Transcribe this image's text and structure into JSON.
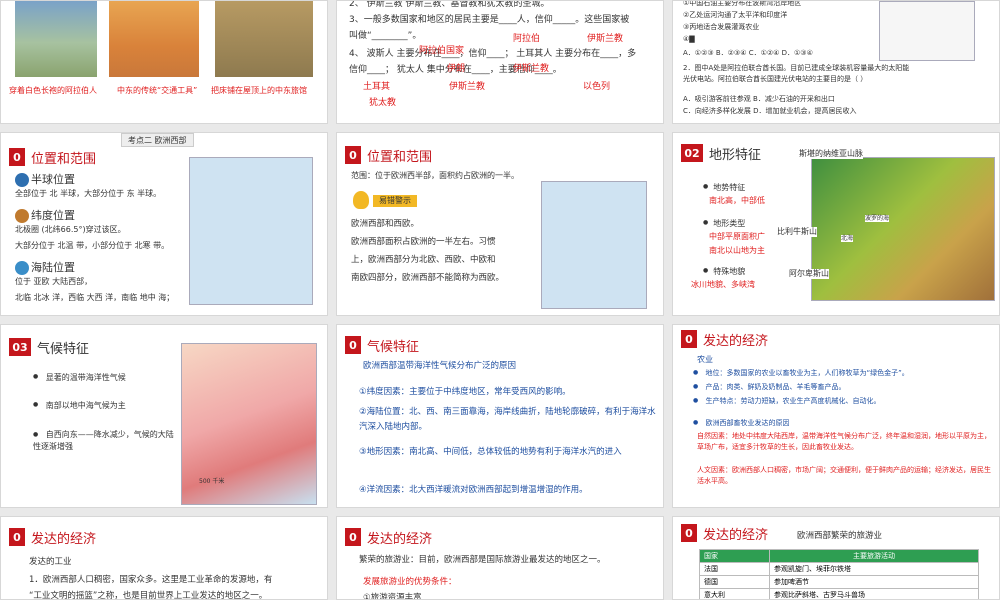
{
  "s1": {
    "captions": [
      "穿着白色长袍的阿拉伯人",
      "中东的传统“交通工具”",
      "把床铺在屋顶上的中东旅馆"
    ]
  },
  "s2": {
    "line2": "2、  伊斯兰教  伊斯兰教、基督教和犹太教的圣城。",
    "line3": "3、一般多数国家和地区的居民主要是____人，信仰_____。这些国家被",
    "line3b": "叫做“________”。",
    "line4": "4、  波斯人  主要分布在____，信仰____；  土耳其人  主要分布在____，多",
    "line4b": "信仰____；  犹太人  集中分布在____，主要信仰____。",
    "answers": [
      "阿拉伯",
      "伊斯兰教",
      "阿拉伯国家",
      "伊朗",
      "伊斯兰教",
      "土耳其",
      "伊斯兰教",
      "以色列",
      "犹太教"
    ]
  },
  "s3": {
    "opts": [
      "①中国石油主要分布在波斯湾沿岸地区",
      "②乙处运河沟通了太平洋和印度洋",
      "③丙地适合发展灌溉农业",
      "④▇"
    ],
    "choices": "A．①②③    B．②③④    C．①②④    D．①③④",
    "q2": "2．图中A处是阿拉伯联合酋长国。目前已建成全球装机容量最大的太阳能光伏电站。阿拉伯联合酋长国建光伏电站的主要目的是（    ）",
    "a2": "A．吸引游客前往参观      B．减少石油的开采和出口",
    "c2": "C．向经济多样化发展      D．增加就业机会，提高居民收入"
  },
  "s4": {
    "tab": "考点二  欧洲西部",
    "num": "0",
    "title": "位置和范围",
    "hemi_title": "半球位置",
    "hemi": "全部位于  北  半球，大部分位于  东  半球。",
    "lat_title": "纬度位置",
    "lat1": "北极圈  (北纬66.5°)穿过该区。",
    "lat2": "大部分位于  北温  带，小部分位于  北寒  带。",
    "sea_title": "海陆位置",
    "sea1": "位于  亚欧  大陆西部，",
    "sea2": "北临  北冰  洋，西临  大西  洋，南临  地中  海；"
  },
  "s5": {
    "num": "0",
    "title": "位置和范围",
    "range": "范围：位于欧洲西半部，面积约占欧洲的一半。",
    "warn": "易错警示",
    "w1": "欧洲西部和西欧。",
    "w2": "欧洲西部面积占欧洲的一半左右。习惯",
    "w3": "上，欧洲西部分为北欧、西欧、中欧和",
    "w4": "南欧四部分，欧洲西部不能简称为西欧。"
  },
  "s6": {
    "num": "02",
    "title": "地形特征",
    "labels": [
      "斯堪的纳维亚山脉",
      "比利牛斯山",
      "阿尔卑斯山",
      "波罗的海",
      "北海"
    ],
    "b1": "地势特征",
    "b1a": "南北高，中部低",
    "b2": "地形类型",
    "b2a": "中部平原面积广",
    "b2b": "南北以山地为主",
    "b3": "特殊地貌",
    "b3a": "冰川地貌、多峡湾"
  },
  "s7": {
    "num": "03",
    "title": "气候特征",
    "b1": "显著的温带海洋性气候",
    "b2": "南部以地中海气候为主",
    "b3": "自西向东——降水减少，气候的大陆性逐渐增强",
    "scale": "500 千米"
  },
  "s8": {
    "num": "0",
    "title": "气候特征",
    "sub": "欧洲西部温带海洋性气候分布广泛的原因",
    "r1": "①纬度因素：主要位于中纬度地区，常年受西风的影响。",
    "r2": "②海陆位置：北、西、南三面靠海，海岸线曲折，陆地轮廓破碎，有利于海洋水汽深入陆地内部。",
    "r3": "③地形因素：南北高、中间低，总体较低的地势有利于海洋水汽的进入",
    "r4": "④洋流因素：北大西洋暖流对欧洲西部起到增温增湿的作用。"
  },
  "s9": {
    "num": "0",
    "title": "发达的经济",
    "h": "农业",
    "l1": "地位：多数国家的农业以畜牧业为主，人们称牧草为“绿色金子”。",
    "l2": "产品：肉类、鲜奶及奶制品、羊毛等畜产品。",
    "l3": "生产特点：劳动力短缺，农业生产高度机械化、自动化。",
    "h2": "欧洲西部畜牧业发达的原因",
    "nat": "自然因素：地处中纬度大陆西岸，温带海洋性气候分布广泛，终年温和湿润，地形以平原为主，草场广布，适宜多汁牧草的生长，因此畜牧业发达。",
    "hum": "人文因素：欧洲西部人口稠密，市场广阔；交通便利，便于鲜肉产品的运输；经济发达，居民生活水平高。"
  },
  "s10": {
    "num": "0",
    "title": "发达的经济",
    "h": "发达的工业",
    "l1": "1．欧洲西部人口稠密，国家众多。这里是工业革命的发源地，有",
    "l2": "“工业文明的摇篮”之称，也是目前世界上工业发达的地区之一。"
  },
  "s11": {
    "num": "0",
    "title": "发达的经济",
    "l1": "繁荣的旅游业：目前，欧洲西部是国际旅游业最发达的地区之一。",
    "h": "发展旅游业的优势条件：",
    "l2": "①旅游资源丰富"
  },
  "s12": {
    "num": "0",
    "title": "发达的经济",
    "caption": "欧洲西部繁荣的旅游业",
    "cols": [
      "国家",
      "主要旅游活动"
    ],
    "rows": [
      [
        "法国",
        "参观凯旋门、埃菲尔铁塔"
      ],
      [
        "德国",
        "参加啤酒节"
      ],
      [
        "意大利",
        "参观比萨斜塔、古罗马斗兽场"
      ]
    ]
  }
}
